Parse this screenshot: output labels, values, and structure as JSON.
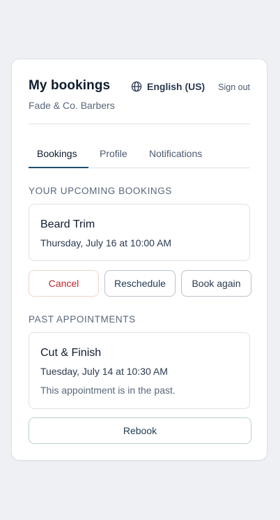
{
  "header": {
    "title": "My bookings",
    "subtitle": "Fade & Co. Barbers",
    "language_label": "English (US)",
    "language_icon": "globe-icon",
    "signout_label": "Sign out"
  },
  "tabs": [
    {
      "label": "Bookings",
      "active": true
    },
    {
      "label": "Profile",
      "active": false
    },
    {
      "label": "Notifications",
      "active": false
    }
  ],
  "upcoming": {
    "heading": "YOUR UPCOMING BOOKINGS",
    "booking": {
      "service": "Beard Trim",
      "datetime": "Thursday, July 16 at 10:00 AM"
    },
    "actions": {
      "cancel": "Cancel",
      "reschedule": "Reschedule",
      "book_again": "Book again"
    }
  },
  "past": {
    "heading": "PAST APPOINTMENTS",
    "booking": {
      "service": "Cut & Finish",
      "datetime": "Tuesday, July 14 at 10:30 AM",
      "note": "This appointment is in the past."
    },
    "rebook_label": "Rebook"
  },
  "colors": {
    "background": "#eef0f4",
    "accent": "#1e4e6b",
    "danger": "#c0282b"
  }
}
